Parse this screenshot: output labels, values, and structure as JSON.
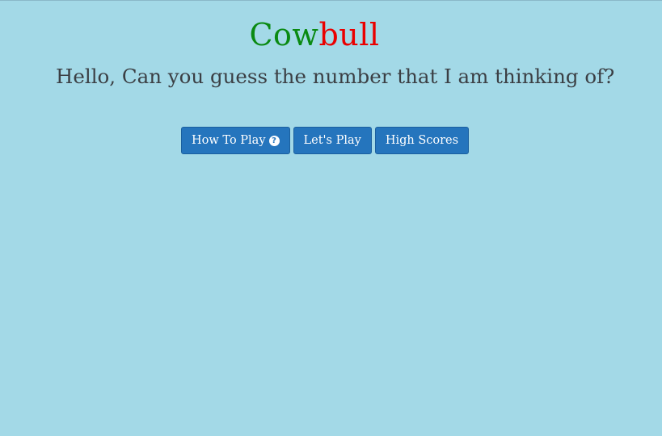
{
  "header": {
    "title_part1": "Cow",
    "title_part2": "bull",
    "tagline": "Hello, Can you guess the number that I am thinking of?"
  },
  "buttons": {
    "how_to_play": "How To Play",
    "lets_play": "Let's Play",
    "high_scores": "High Scores"
  },
  "icons": {
    "help": "question-circle-icon"
  },
  "colors": {
    "background": "#a3d9e7",
    "cow": "#0a8a12",
    "bull": "#ea0000",
    "button": "#2575bd",
    "text": "#3b3f44"
  }
}
